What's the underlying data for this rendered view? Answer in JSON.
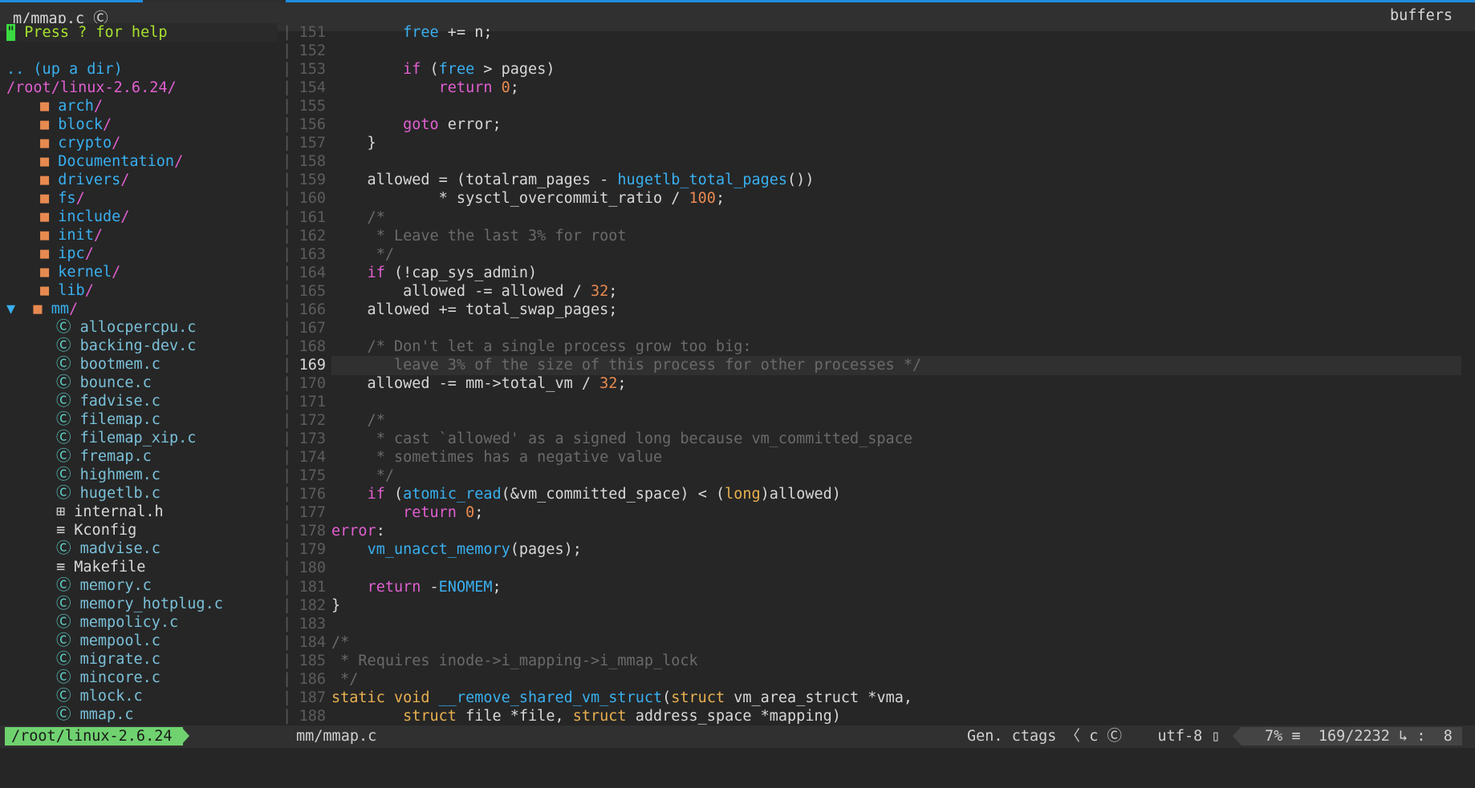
{
  "tabline": {
    "title": "m/mmap.c",
    "icon": "c-file-icon",
    "right": "buffers"
  },
  "tree": {
    "help": "Press ? for help",
    "up_dir": ".. (up a dir)",
    "root": "/root/linux-2.6.24/",
    "folders": [
      "arch",
      "block",
      "crypto",
      "Documentation",
      "drivers",
      "fs",
      "include",
      "init",
      "ipc",
      "kernel",
      "lib"
    ],
    "open_folder": "mm",
    "files": [
      {
        "name": "allocpercpu.c",
        "type": "c"
      },
      {
        "name": "backing-dev.c",
        "type": "c"
      },
      {
        "name": "bootmem.c",
        "type": "c"
      },
      {
        "name": "bounce.c",
        "type": "c"
      },
      {
        "name": "fadvise.c",
        "type": "c"
      },
      {
        "name": "filemap.c",
        "type": "c"
      },
      {
        "name": "filemap_xip.c",
        "type": "c"
      },
      {
        "name": "fremap.c",
        "type": "c"
      },
      {
        "name": "highmem.c",
        "type": "c"
      },
      {
        "name": "hugetlb.c",
        "type": "c"
      },
      {
        "name": "internal.h",
        "type": "h"
      },
      {
        "name": "Kconfig",
        "type": "text"
      },
      {
        "name": "madvise.c",
        "type": "c"
      },
      {
        "name": "Makefile",
        "type": "text"
      },
      {
        "name": "memory.c",
        "type": "c"
      },
      {
        "name": "memory_hotplug.c",
        "type": "c"
      },
      {
        "name": "mempolicy.c",
        "type": "c"
      },
      {
        "name": "mempool.c",
        "type": "c"
      },
      {
        "name": "migrate.c",
        "type": "c"
      },
      {
        "name": "mincore.c",
        "type": "c"
      },
      {
        "name": "mlock.c",
        "type": "c"
      },
      {
        "name": "mmap.c",
        "type": "c"
      }
    ]
  },
  "editor": {
    "current_line": 169,
    "lines": [
      {
        "n": 151,
        "t": [
          [
            "",
            "        "
          ],
          [
            "fn",
            "free"
          ],
          [
            "",
            " += n;"
          ]
        ]
      },
      {
        "n": 152,
        "t": []
      },
      {
        "n": 153,
        "t": [
          [
            "",
            "        "
          ],
          [
            "kw",
            "if"
          ],
          [
            "",
            " ("
          ],
          [
            "fn",
            "free"
          ],
          [
            "",
            " > pages)"
          ]
        ]
      },
      {
        "n": 154,
        "t": [
          [
            "",
            "            "
          ],
          [
            "kw",
            "return"
          ],
          [
            "",
            " "
          ],
          [
            "num",
            "0"
          ],
          [
            "",
            ";"
          ]
        ]
      },
      {
        "n": 155,
        "t": []
      },
      {
        "n": 156,
        "t": [
          [
            "",
            "        "
          ],
          [
            "kw",
            "goto"
          ],
          [
            "",
            " error;"
          ]
        ]
      },
      {
        "n": 157,
        "t": [
          [
            "",
            "    }"
          ]
        ]
      },
      {
        "n": 158,
        "t": []
      },
      {
        "n": 159,
        "t": [
          [
            "",
            "    allowed = (totalram_pages - "
          ],
          [
            "fn",
            "hugetlb_total_pages"
          ],
          [
            "",
            "())"
          ]
        ]
      },
      {
        "n": 160,
        "t": [
          [
            "",
            "            * sysctl_overcommit_ratio / "
          ],
          [
            "num",
            "100"
          ],
          [
            "",
            ";"
          ]
        ]
      },
      {
        "n": 161,
        "t": [
          [
            "cm",
            "    /*"
          ]
        ]
      },
      {
        "n": 162,
        "t": [
          [
            "cm",
            "     * Leave the last 3% for root"
          ]
        ]
      },
      {
        "n": 163,
        "t": [
          [
            "cm",
            "     */"
          ]
        ]
      },
      {
        "n": 164,
        "t": [
          [
            "",
            "    "
          ],
          [
            "kw",
            "if"
          ],
          [
            "",
            " (!cap_sys_admin)"
          ]
        ]
      },
      {
        "n": 165,
        "t": [
          [
            "",
            "        allowed -= allowed / "
          ],
          [
            "num",
            "32"
          ],
          [
            "",
            ";"
          ]
        ]
      },
      {
        "n": 166,
        "t": [
          [
            "",
            "    allowed += total_swap_pages;"
          ]
        ]
      },
      {
        "n": 167,
        "t": []
      },
      {
        "n": 168,
        "t": [
          [
            "cm",
            "    /* Don't let a single process grow too big:"
          ]
        ]
      },
      {
        "n": 169,
        "t": [
          [
            "cm",
            "       leave 3% of the size of this process for other processes */"
          ]
        ]
      },
      {
        "n": 170,
        "t": [
          [
            "",
            "    allowed -= mm->total_vm / "
          ],
          [
            "num",
            "32"
          ],
          [
            "",
            ";"
          ]
        ]
      },
      {
        "n": 171,
        "t": []
      },
      {
        "n": 172,
        "t": [
          [
            "cm",
            "    /*"
          ]
        ]
      },
      {
        "n": 173,
        "t": [
          [
            "cm",
            "     * cast `allowed' as a signed long because vm_committed_space"
          ]
        ]
      },
      {
        "n": 174,
        "t": [
          [
            "cm",
            "     * sometimes has a negative value"
          ]
        ]
      },
      {
        "n": 175,
        "t": [
          [
            "cm",
            "     */"
          ]
        ]
      },
      {
        "n": 176,
        "t": [
          [
            "",
            "    "
          ],
          [
            "kw",
            "if"
          ],
          [
            "",
            " ("
          ],
          [
            "fn",
            "atomic_read"
          ],
          [
            "",
            "(&vm_committed_space) < ("
          ],
          [
            "ty",
            "long"
          ],
          [
            "",
            ")allowed)"
          ]
        ]
      },
      {
        "n": 177,
        "t": [
          [
            "",
            "        "
          ],
          [
            "kw",
            "return"
          ],
          [
            "",
            " "
          ],
          [
            "num",
            "0"
          ],
          [
            "",
            ";"
          ]
        ]
      },
      {
        "n": 178,
        "t": [
          [
            "kw",
            "error"
          ],
          [
            "",
            ":"
          ]
        ]
      },
      {
        "n": 179,
        "t": [
          [
            "",
            "    "
          ],
          [
            "fn",
            "vm_unacct_memory"
          ],
          [
            "",
            "(pages);"
          ]
        ]
      },
      {
        "n": 180,
        "t": []
      },
      {
        "n": 181,
        "t": [
          [
            "",
            "    "
          ],
          [
            "kw",
            "return"
          ],
          [
            "",
            " -"
          ],
          [
            "fn",
            "ENOMEM"
          ],
          [
            "",
            ";"
          ]
        ]
      },
      {
        "n": 182,
        "t": [
          [
            "",
            "}"
          ]
        ]
      },
      {
        "n": 183,
        "t": []
      },
      {
        "n": 184,
        "t": [
          [
            "cm",
            "/*"
          ]
        ]
      },
      {
        "n": 185,
        "t": [
          [
            "cm",
            " * Requires inode->i_mapping->i_mmap_lock"
          ]
        ]
      },
      {
        "n": 186,
        "t": [
          [
            "cm",
            " */"
          ]
        ]
      },
      {
        "n": 187,
        "t": [
          [
            "ty",
            "static"
          ],
          [
            "",
            " "
          ],
          [
            "ty",
            "void"
          ],
          [
            "",
            " "
          ],
          [
            "fn",
            "__remove_shared_vm_struct"
          ],
          [
            "",
            "("
          ],
          [
            "ty",
            "struct"
          ],
          [
            "",
            " vm_area_struct *vma,"
          ]
        ]
      },
      {
        "n": 188,
        "t": [
          [
            "",
            "        "
          ],
          [
            "ty",
            "struct"
          ],
          [
            "",
            " file *file, "
          ],
          [
            "ty",
            "struct"
          ],
          [
            "",
            " address_space *mapping)"
          ]
        ]
      }
    ]
  },
  "statusline": {
    "tree_path": "/root/linux-2.6.24",
    "file": "mm/mmap.c",
    "tags": "Gen. ctags",
    "filetype": "c",
    "encoding": "utf-8",
    "percent": "7%",
    "position": "169/2232",
    "column": "8"
  }
}
